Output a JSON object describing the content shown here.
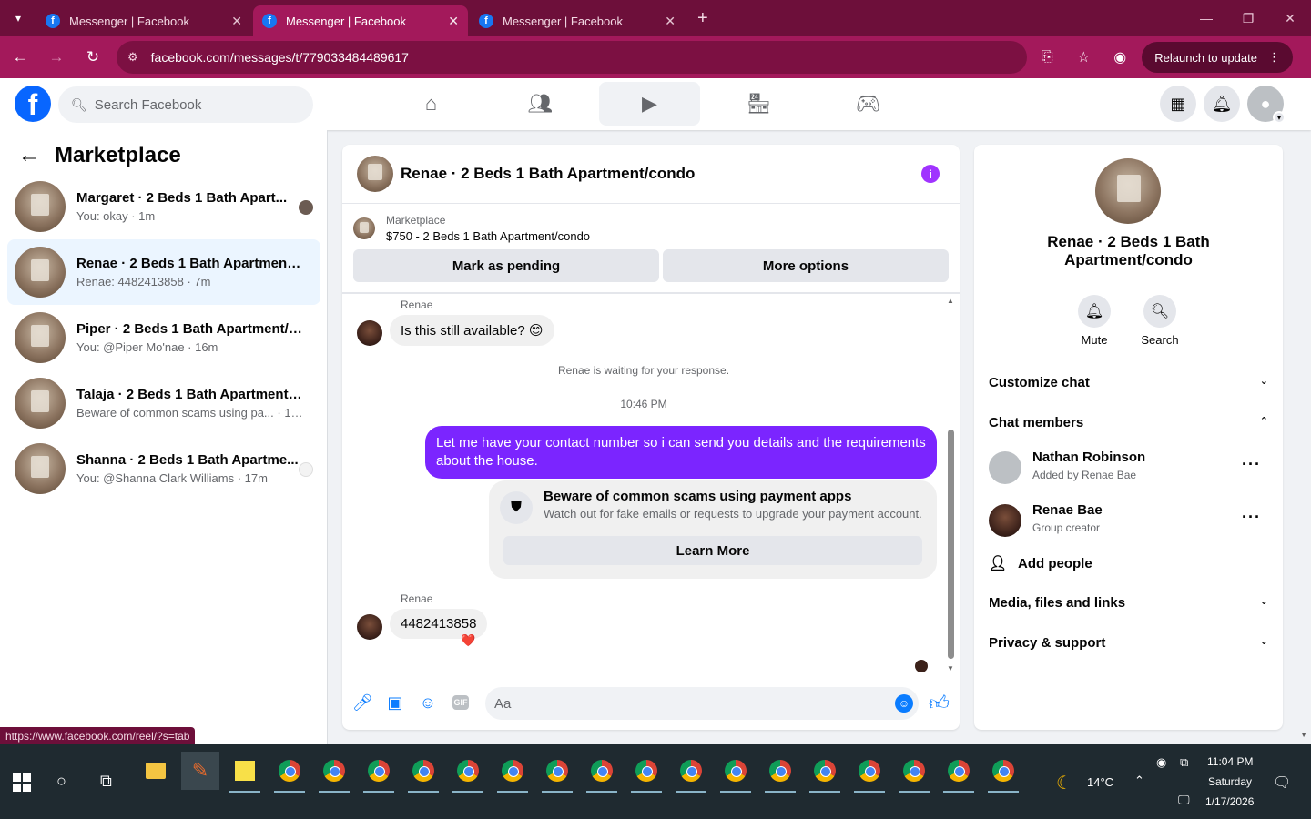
{
  "browser": {
    "tabs": [
      {
        "title": "Messenger | Facebook",
        "active": false
      },
      {
        "title": "Messenger | Facebook",
        "active": true
      },
      {
        "title": "Messenger | Facebook",
        "active": false
      }
    ],
    "url": "facebook.com/messages/t/779033484489617",
    "relaunch_label": "Relaunch to update",
    "status_url": "https://www.facebook.com/reel/?s=tab"
  },
  "facebook": {
    "logo_letter": "f",
    "search_placeholder": "Search Facebook"
  },
  "sidebar": {
    "title": "Marketplace",
    "conversations": [
      {
        "name": "Margaret · 2 Beds 1 Bath Apart...",
        "preview": "You: okay · 1m",
        "selected": false
      },
      {
        "name": "Renae · 2 Beds 1 Bath Apartment/c...",
        "preview": "Renae: 4482413858 · 7m",
        "selected": true
      },
      {
        "name": "Piper · 2 Beds 1 Bath Apartment/c...",
        "preview": "You: @Piper Mo'nae · 16m",
        "selected": false
      },
      {
        "name": "Talaja · 2 Beds 1 Bath Apartment/c...",
        "preview": "Beware of common scams using pa... · 17m",
        "selected": false
      },
      {
        "name": "Shanna · 2 Beds 1 Bath Apartme...",
        "preview": "You: @Shanna Clark Williams · 17m",
        "selected": false
      }
    ]
  },
  "chat": {
    "title": "Renae · 2 Beds 1 Bath Apartment/condo",
    "listing_label": "Marketplace",
    "listing_price": "$750 - 2 Beds 1 Bath Apartment/condo",
    "mark_pending_label": "Mark as pending",
    "more_options_label": "More options",
    "messages": {
      "sender1": "Renae",
      "msg1": "Is this still available? 😊",
      "waiting": "Renae is waiting for your response.",
      "time": "10:46 PM",
      "outgoing": "Let me have your contact number so i can send you details and the requirements about the house.",
      "scam_title": "Beware of common scams using payment apps",
      "scam_desc": "Watch out for fake emails or requests to upgrade your payment account.",
      "learn_more": "Learn More",
      "sender2": "Renae",
      "msg2": "4482413858",
      "reaction": "❤️"
    },
    "composer_placeholder": "Aa"
  },
  "details": {
    "name": "Renae · 2 Beds 1 Bath Apartment/condo",
    "mute_label": "Mute",
    "search_label": "Search",
    "customize": "Customize chat",
    "members_title": "Chat members",
    "members": [
      {
        "name": "Nathan Robinson",
        "sub": "Added by Renae Bae"
      },
      {
        "name": "Renae Bae",
        "sub": "Group creator"
      }
    ],
    "add_people": "Add people",
    "media": "Media, files and links",
    "privacy": "Privacy & support"
  },
  "taskbar": {
    "temp": "14°C",
    "time": "11:04 PM",
    "day": "Saturday",
    "date": "1/17/2026"
  },
  "colors": {
    "chrome_tabbar": "#6d0f3a",
    "chrome_toolbar": "#a3195b",
    "outgoing_bubble": "#7b25ff",
    "fb_blue": "#0866ff"
  }
}
